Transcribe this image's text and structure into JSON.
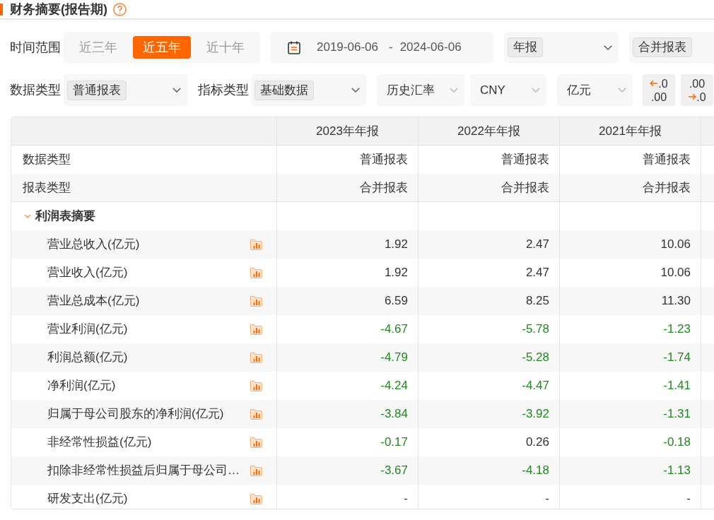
{
  "header": {
    "title": "财务摘要(报告期)"
  },
  "filters": {
    "time_range": {
      "label": "时间范围",
      "options": [
        {
          "label": "近三年",
          "selected": false
        },
        {
          "label": "近五年",
          "selected": true
        },
        {
          "label": "近十年",
          "selected": false
        }
      ],
      "date_start": "2019-06-06",
      "separator": "-",
      "date_end": "2024-06-06"
    },
    "report_period": {
      "tag": "年报"
    },
    "report_scope": {
      "tag": "合并报表"
    },
    "data_type": {
      "label": "数据类型",
      "tag": "普通报表"
    },
    "indicator_type": {
      "label": "指标类型",
      "tag": "基础数据"
    },
    "exchange_rate": {
      "value": "历史汇率"
    },
    "currency": {
      "value": "CNY"
    },
    "unit": {
      "value": "亿元"
    },
    "decimal_buttons": [
      {
        "kind": "decrease",
        "top": ".0",
        "bottom": ".00"
      },
      {
        "kind": "increase",
        "top": ".00",
        "bottom": ".0"
      }
    ]
  },
  "table": {
    "columns": [
      "2023年年报",
      "2022年年报",
      "2021年年报"
    ],
    "info_rows": [
      {
        "label": "数据类型",
        "values": [
          "普通报表",
          "普通报表",
          "普通报表"
        ]
      },
      {
        "label": "报表类型",
        "values": [
          "合并报表",
          "合并报表",
          "合并报表"
        ]
      }
    ],
    "sections": [
      {
        "title": "利润表摘要",
        "expanded": true,
        "rows": [
          {
            "label": "营业总收入(亿元)",
            "values": [
              {
                "text": "1.92",
                "color": "#333333"
              },
              {
                "text": "2.47",
                "color": "#333333"
              },
              {
                "text": "10.06",
                "color": "#333333"
              }
            ]
          },
          {
            "label": "营业收入(亿元)",
            "values": [
              {
                "text": "1.92",
                "color": "#333333"
              },
              {
                "text": "2.47",
                "color": "#333333"
              },
              {
                "text": "10.06",
                "color": "#333333"
              }
            ]
          },
          {
            "label": "营业总成本(亿元)",
            "values": [
              {
                "text": "6.59",
                "color": "#333333"
              },
              {
                "text": "8.25",
                "color": "#333333"
              },
              {
                "text": "11.30",
                "color": "#333333"
              }
            ]
          },
          {
            "label": "营业利润(亿元)",
            "values": [
              {
                "text": "-4.67",
                "color": "#1e8a1e"
              },
              {
                "text": "-5.78",
                "color": "#1e8a1e"
              },
              {
                "text": "-1.23",
                "color": "#1e8a1e"
              }
            ]
          },
          {
            "label": "利润总额(亿元)",
            "values": [
              {
                "text": "-4.79",
                "color": "#1e8a1e"
              },
              {
                "text": "-5.28",
                "color": "#1e8a1e"
              },
              {
                "text": "-1.74",
                "color": "#1e8a1e"
              }
            ]
          },
          {
            "label": "净利润(亿元)",
            "values": [
              {
                "text": "-4.24",
                "color": "#1e8a1e"
              },
              {
                "text": "-4.47",
                "color": "#1e8a1e"
              },
              {
                "text": "-1.41",
                "color": "#1e8a1e"
              }
            ]
          },
          {
            "label": "归属于母公司股东的净利润(亿元)",
            "values": [
              {
                "text": "-3.84",
                "color": "#1e8a1e"
              },
              {
                "text": "-3.92",
                "color": "#1e8a1e"
              },
              {
                "text": "-1.31",
                "color": "#1e8a1e"
              }
            ]
          },
          {
            "label": "非经常性损益(亿元)",
            "values": [
              {
                "text": "-0.17",
                "color": "#1e8a1e"
              },
              {
                "text": "0.26",
                "color": "#333333"
              },
              {
                "text": "-0.18",
                "color": "#1e8a1e"
              }
            ]
          },
          {
            "label": "扣除非经常性损益后归属于母公司…",
            "values": [
              {
                "text": "-3.67",
                "color": "#1e8a1e"
              },
              {
                "text": "-4.18",
                "color": "#1e8a1e"
              },
              {
                "text": "-1.13",
                "color": "#1e8a1e"
              }
            ]
          },
          {
            "label": "研发支出(亿元)",
            "values": [
              {
                "text": "-",
                "color": "#333333"
              },
              {
                "text": "-",
                "color": "#333333"
              },
              {
                "text": "-",
                "color": "#333333"
              }
            ]
          }
        ]
      }
    ]
  }
}
